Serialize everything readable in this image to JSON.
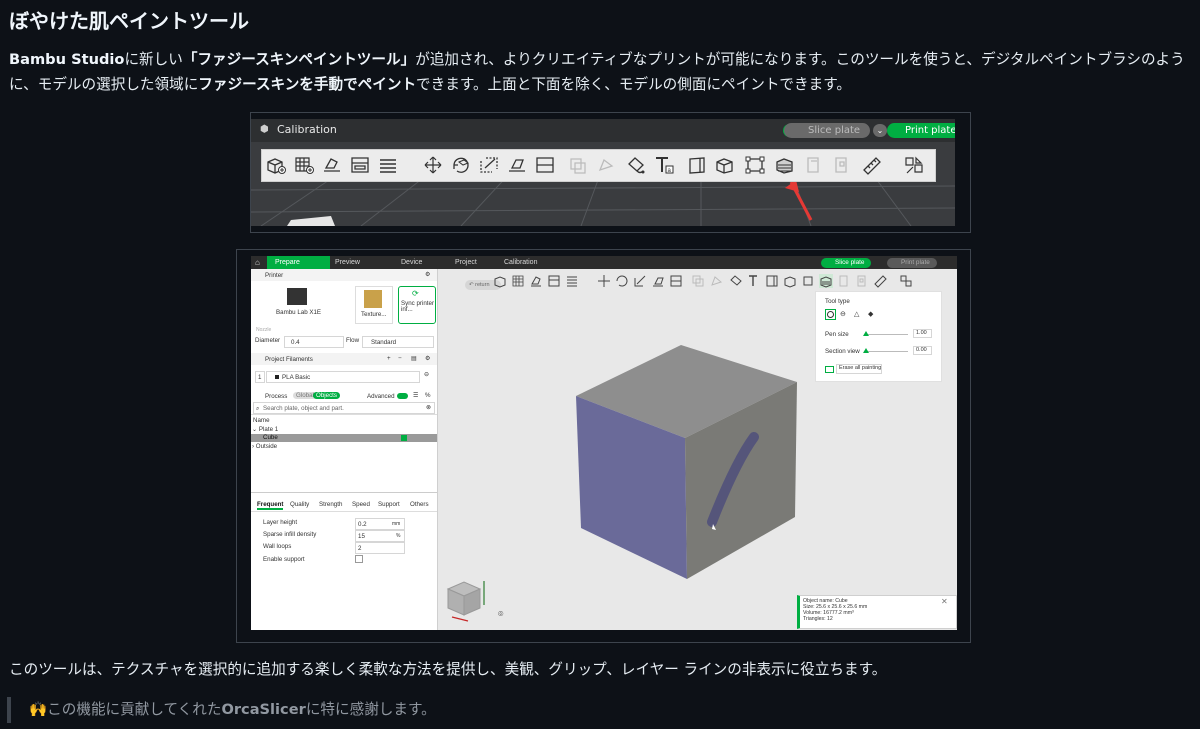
{
  "heading": "ぼやけた肌ペイントツール",
  "intro": {
    "p1": "Bambu Studio",
    "p2": "に新しい",
    "p3": "「ファジースキンペイントツール」",
    "p4": "が追加され、よりクリエイティブなプリントが可能になります。このツールを使うと、デジタルペイントブラシのように、モデルの選択した領域に",
    "p5": "ファジースキンを手動でペイント",
    "p6": "できます。上面と下面を除く、モデルの側面にペイントできます。"
  },
  "image1": {
    "window_title": "Calibration",
    "slice_label": "Slice plate",
    "print_label": "Print plate"
  },
  "image2": {
    "tabs": [
      "Prepare",
      "Preview",
      "Device",
      "Project",
      "Calibration"
    ],
    "slice_label": "Slice plate",
    "print_label": "Print plate",
    "return_label": "return",
    "printer": {
      "section": "Printer",
      "name": "Bambu Lab X1E",
      "plate": "Texture...",
      "sync": "Sync printer inf...",
      "nozzle_caption": "Nozzle",
      "diameter_label": "Diameter",
      "diameter_value": "0.4",
      "flow_label": "Flow",
      "flow_value": "Standard"
    },
    "filaments": {
      "section": "Project Filaments",
      "slot": "1",
      "name": "PLA Basic"
    },
    "process": {
      "section": "Process",
      "global_label": "Global",
      "objects_label": "Objects",
      "advanced_label": "Advanced",
      "search_placeholder": "Search plate, object and part.",
      "tree_header": "Name",
      "tree": [
        "Plate 1",
        "Cube",
        "Outside"
      ]
    },
    "settings_tabs": [
      "Frequent",
      "Quality",
      "Strength",
      "Speed",
      "Support",
      "Others"
    ],
    "settings": {
      "layer_height_label": "Layer height",
      "layer_height_value": "0.2",
      "layer_height_unit": "mm",
      "infill_label": "Sparse infill density",
      "infill_value": "15",
      "infill_unit": "%",
      "wall_label": "Wall loops",
      "wall_value": "2",
      "support_label": "Enable support"
    },
    "tool_panel": {
      "title": "Tool type",
      "pen_label": "Pen size",
      "pen_value": "1.00",
      "pen_level": 0.0,
      "section_label": "Section view",
      "section_value": "0.00",
      "section_level": 0.0,
      "erase_label": "Erase all painting"
    },
    "info": {
      "name": "Object name: Cube",
      "size": "Size: 25.6 x 25.6 x 25.6 mm",
      "volume": "Volume: 16777.2 mm³",
      "triangles": "Triangles: 12"
    },
    "colors": {
      "accent": "#00ae42",
      "painted_side": "#6a6a99"
    }
  },
  "outro": "このツールは、テクスチャを選択的に追加する楽しく柔軟な方法を提供し、美観、グリップ、レイヤー ラインの非表示に役立ちます。",
  "quote": {
    "emoji": "🙌",
    "q1": "この機能に貢献してくれた",
    "q2": "OrcaSlicer",
    "q3": "に特に感謝します。"
  }
}
